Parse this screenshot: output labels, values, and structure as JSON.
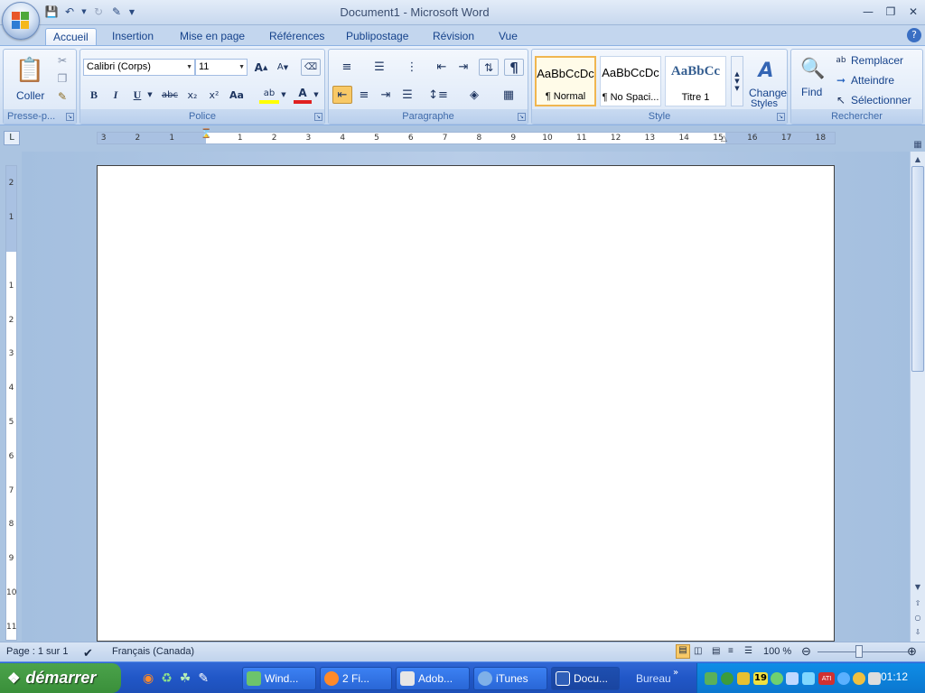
{
  "window": {
    "title": "Document1 - Microsoft Word",
    "help": "?"
  },
  "qat": {
    "save_icon": "save-icon",
    "undo_icon": "undo-icon",
    "redo_icon": "redo-icon",
    "customize_icon": "customize-icon"
  },
  "tabs": [
    "Accueil",
    "Insertion",
    "Mise en page",
    "Références",
    "Publipostage",
    "Révision",
    "Vue"
  ],
  "ribbon": {
    "clipboard": {
      "label": "Presse-p...",
      "paste": "Coller"
    },
    "font": {
      "label": "Police",
      "font_name": "Calibri (Corps)",
      "font_size": "11",
      "bold": "B",
      "italic": "I",
      "underline": "U",
      "strike": "abc",
      "sub": "x₂",
      "sup": "x²",
      "case": "Aa",
      "color": "A",
      "grow": "A",
      "shrink": "A"
    },
    "paragraph": {
      "label": "Paragraphe",
      "pilcrow": "¶"
    },
    "style": {
      "label": "Style",
      "styles": [
        {
          "preview": "AaBbCcDc",
          "name": "¶ Normal"
        },
        {
          "preview": "AaBbCcDc",
          "name": "¶ No Spaci..."
        },
        {
          "preview": "AaBbCc",
          "name": "Titre 1"
        }
      ],
      "change_styles": "Change",
      "change_styles2": "Styles"
    },
    "editing": {
      "label": "Rechercher",
      "find": "Find",
      "replace": "Remplacer",
      "goto": "Atteindre",
      "select": "Sélectionner"
    }
  },
  "ruler": {
    "corner": "L",
    "h_ticks": [
      "3",
      "2",
      "1",
      "1",
      "2",
      "3",
      "4",
      "5",
      "6",
      "7",
      "8",
      "9",
      "10",
      "11",
      "12",
      "13",
      "14",
      "15",
      "16",
      "17",
      "18"
    ],
    "v_ticks": [
      "2",
      "1",
      "1",
      "2",
      "3",
      "4",
      "5",
      "6",
      "7",
      "8",
      "9",
      "10",
      "11"
    ]
  },
  "status": {
    "page": "Page : 1 sur 1",
    "language": "Français (Canada)",
    "zoom": "100 %"
  },
  "taskbar": {
    "start": "démarrer",
    "items": [
      "Wind...",
      "2 Fi...",
      "Adob...",
      "iTunes",
      "Docu..."
    ],
    "bureau": "Bureau",
    "clock": "01:12",
    "tray_number": "19"
  },
  "colors": {
    "accent": "#15428b",
    "ribbon": "#dbe7f7",
    "taskbar": "#2157c7",
    "start": "#3a8f3a"
  }
}
